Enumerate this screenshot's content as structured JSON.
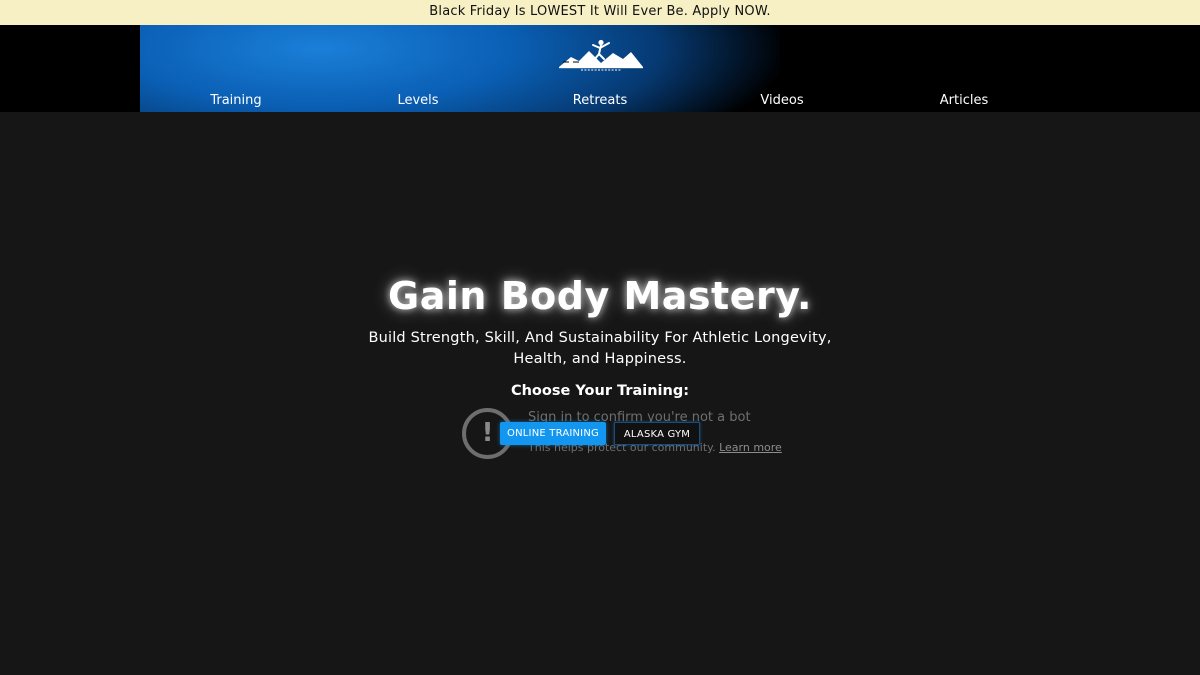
{
  "promo": {
    "text": "Black Friday Is LOWEST It Will Ever Be. Apply NOW."
  },
  "header": {
    "logo_icon": "pacific-athletics-logo-icon"
  },
  "nav": {
    "items": [
      {
        "label": "Training"
      },
      {
        "label": "Levels"
      },
      {
        "label": "Retreats"
      },
      {
        "label": "Videos"
      },
      {
        "label": "Articles"
      }
    ]
  },
  "hero": {
    "title": "Gain Body Mastery.",
    "subtitle": "Build Strength, Skill, And Sustainability For Athletic Longevity, Health, and Happiness.",
    "choose_label": "Choose Your Training:"
  },
  "buttons": {
    "online_training": "ONLINE TRAINING",
    "alaska_gym": "ALASKA GYM"
  },
  "captcha": {
    "icon": "exclamation-icon",
    "title": "Sign in to confirm you're not a bot",
    "note": "This helps protect our community.",
    "link": "Learn more"
  },
  "colors": {
    "promo_bg": "#f6f0c4",
    "accent_blue": "#1296f0",
    "page_bg": "#161616"
  }
}
